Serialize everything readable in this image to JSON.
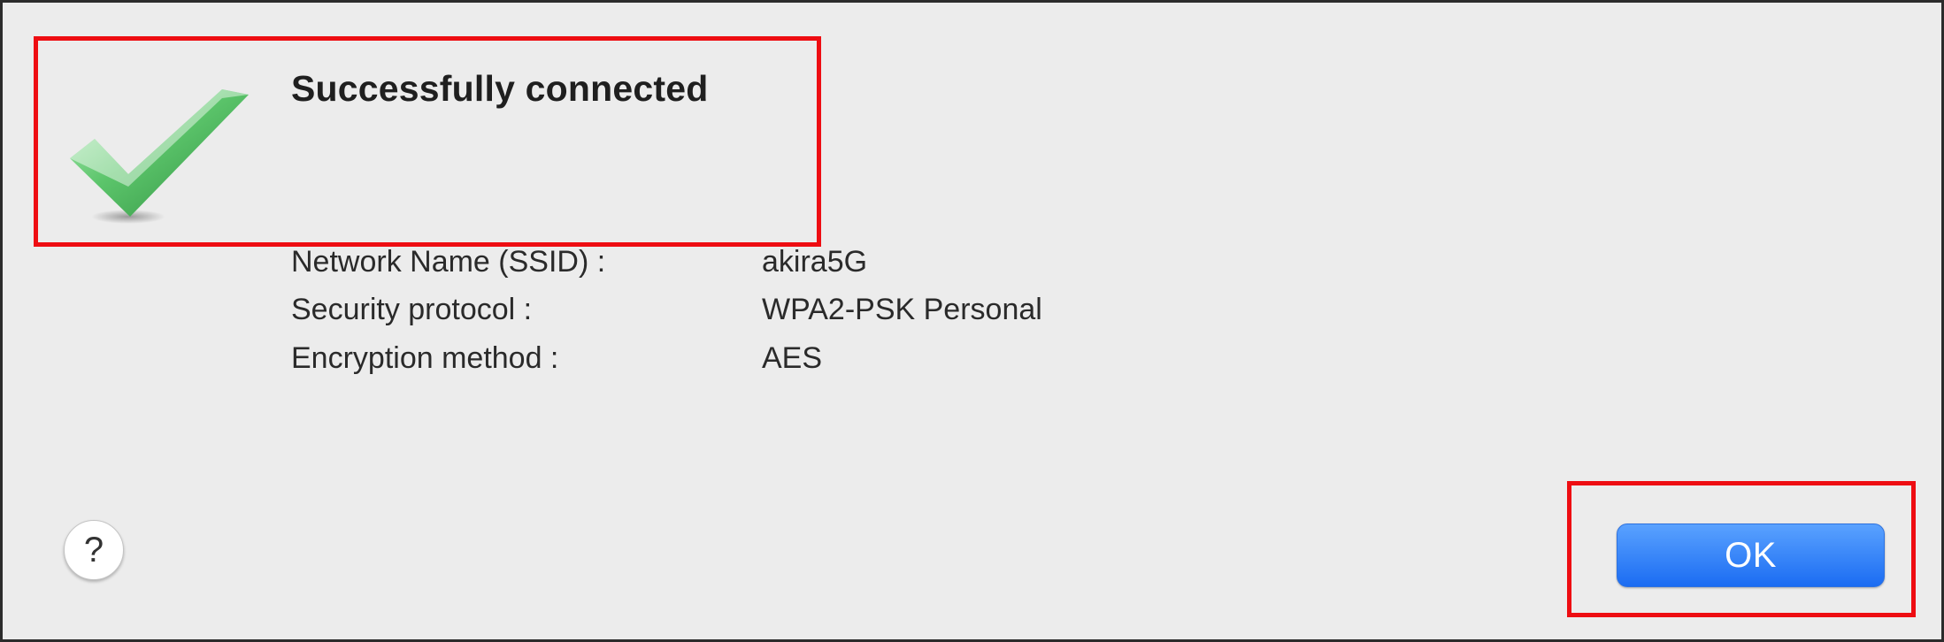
{
  "dialog": {
    "title": "Successfully connected",
    "status_icon": "checkmark-icon",
    "details": [
      {
        "label": "Network Name (SSID) :",
        "value": "akira5G"
      },
      {
        "label": "Security protocol :",
        "value": "WPA2-PSK Personal"
      },
      {
        "label": "Encryption method :",
        "value": "AES"
      }
    ],
    "help_label": "?",
    "ok_label": "OK"
  },
  "colors": {
    "dialog_background": "#ececec",
    "highlight_box": "#ee0d12",
    "ok_button": "#1b6cf2",
    "checkmark_green": "#3ea84f"
  }
}
